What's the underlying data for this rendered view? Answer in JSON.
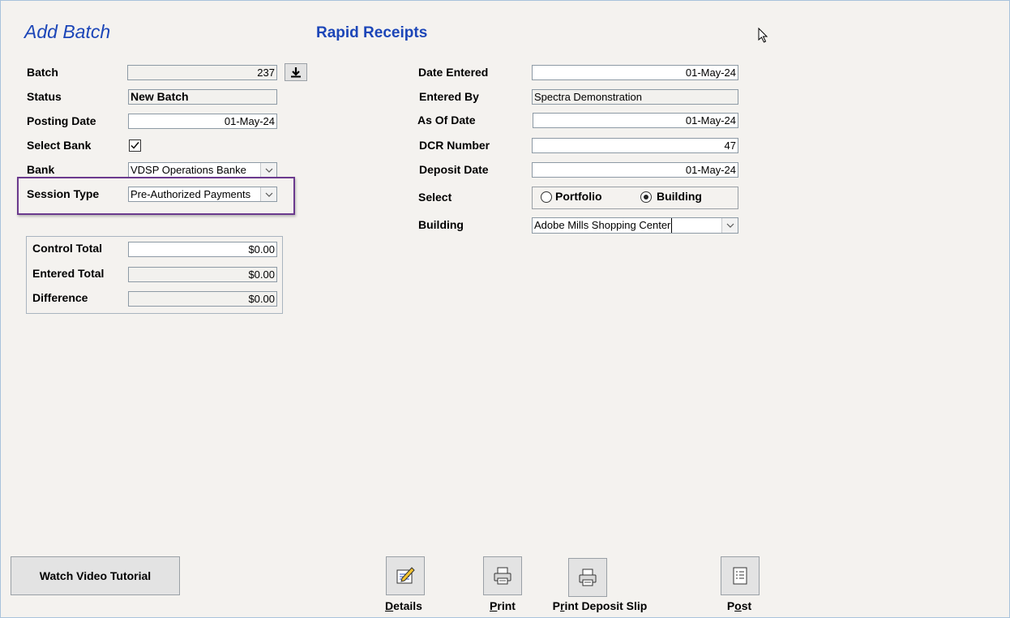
{
  "header": {
    "title": "Add Batch",
    "subtitle": "Rapid Receipts"
  },
  "left": {
    "batch": {
      "label": "Batch",
      "value": "237"
    },
    "status": {
      "label": "Status",
      "value": "New Batch"
    },
    "posting_date": {
      "label": "Posting Date",
      "value": "01-May-24"
    },
    "select_bank": {
      "label": "Select Bank",
      "checked": true
    },
    "bank": {
      "label": "Bank",
      "value": "VDSP Operations Banke"
    },
    "session_type": {
      "label": "Session Type",
      "value": "Pre-Authorized Payments"
    }
  },
  "totals": {
    "control": {
      "label": "Control Total",
      "value": "$0.00"
    },
    "entered": {
      "label": "Entered Total",
      "value": "$0.00"
    },
    "difference": {
      "label": "Difference",
      "value": "$0.00"
    }
  },
  "right": {
    "date_entered": {
      "label": "Date Entered",
      "value": "01-May-24"
    },
    "entered_by": {
      "label": "Entered By",
      "value": "Spectra Demonstration"
    },
    "as_of_date": {
      "label": "As Of Date",
      "value": "01-May-24"
    },
    "dcr_number": {
      "label": "DCR Number",
      "value": "47"
    },
    "deposit_date": {
      "label": "Deposit Date",
      "value": "01-May-24"
    },
    "select": {
      "label": "Select",
      "options": [
        "Portfolio",
        "Building"
      ],
      "selected": "Building"
    },
    "building": {
      "label": "Building",
      "value": "Adobe Mills Shopping Center"
    }
  },
  "footer": {
    "tutorial": "Watch Video Tutorial",
    "details": {
      "u": "D",
      "rest": "etails"
    },
    "print": {
      "u": "P",
      "rest": "rint"
    },
    "print_slip": {
      "a": "P",
      "u": "r",
      "rest": "int Deposit Slip"
    },
    "post": {
      "a": "P",
      "u": "o",
      "rest": "st"
    }
  },
  "colors": {
    "title": "#1c46b8",
    "highlight": "#6b3a8e",
    "background": "#f4f2ef"
  }
}
